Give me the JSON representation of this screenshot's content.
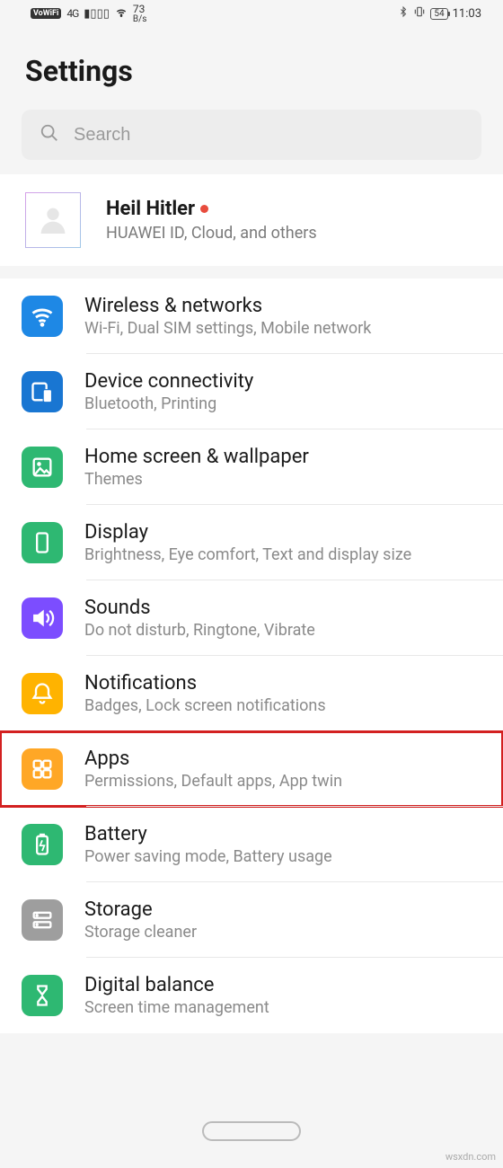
{
  "status": {
    "vowifi": "VoWiFi",
    "network": "4G",
    "speed_num": "73",
    "speed_unit": "B/s",
    "battery": "54",
    "time": "11:03"
  },
  "title": "Settings",
  "search": {
    "placeholder": "Search"
  },
  "profile": {
    "name": "Heil Hitler",
    "subtitle": "HUAWEI ID, Cloud, and others"
  },
  "items": [
    {
      "title": "Wireless & networks",
      "subtitle": "Wi-Fi, Dual SIM settings, Mobile network",
      "icon": "wifi-icon",
      "color": "ic-blue"
    },
    {
      "title": "Device connectivity",
      "subtitle": "Bluetooth, Printing",
      "icon": "device-icon",
      "color": "ic-blue2"
    },
    {
      "title": "Home screen & wallpaper",
      "subtitle": "Themes",
      "icon": "wallpaper-icon",
      "color": "ic-green"
    },
    {
      "title": "Display",
      "subtitle": "Brightness, Eye comfort, Text and display size",
      "icon": "display-icon",
      "color": "ic-green"
    },
    {
      "title": "Sounds",
      "subtitle": "Do not disturb, Ringtone, Vibrate",
      "icon": "sound-icon",
      "color": "ic-purple"
    },
    {
      "title": "Notifications",
      "subtitle": "Badges, Lock screen notifications",
      "icon": "bell-icon",
      "color": "ic-yellow"
    },
    {
      "title": "Apps",
      "subtitle": "Permissions, Default apps, App twin",
      "icon": "apps-icon",
      "color": "ic-orange",
      "highlight": true
    },
    {
      "title": "Battery",
      "subtitle": "Power saving mode, Battery usage",
      "icon": "battery-icon",
      "color": "ic-green"
    },
    {
      "title": "Storage",
      "subtitle": "Storage cleaner",
      "icon": "storage-icon",
      "color": "ic-gray"
    },
    {
      "title": "Digital balance",
      "subtitle": "Screen time management",
      "icon": "hourglass-icon",
      "color": "ic-green"
    }
  ],
  "watermark": "wsxdn.com"
}
